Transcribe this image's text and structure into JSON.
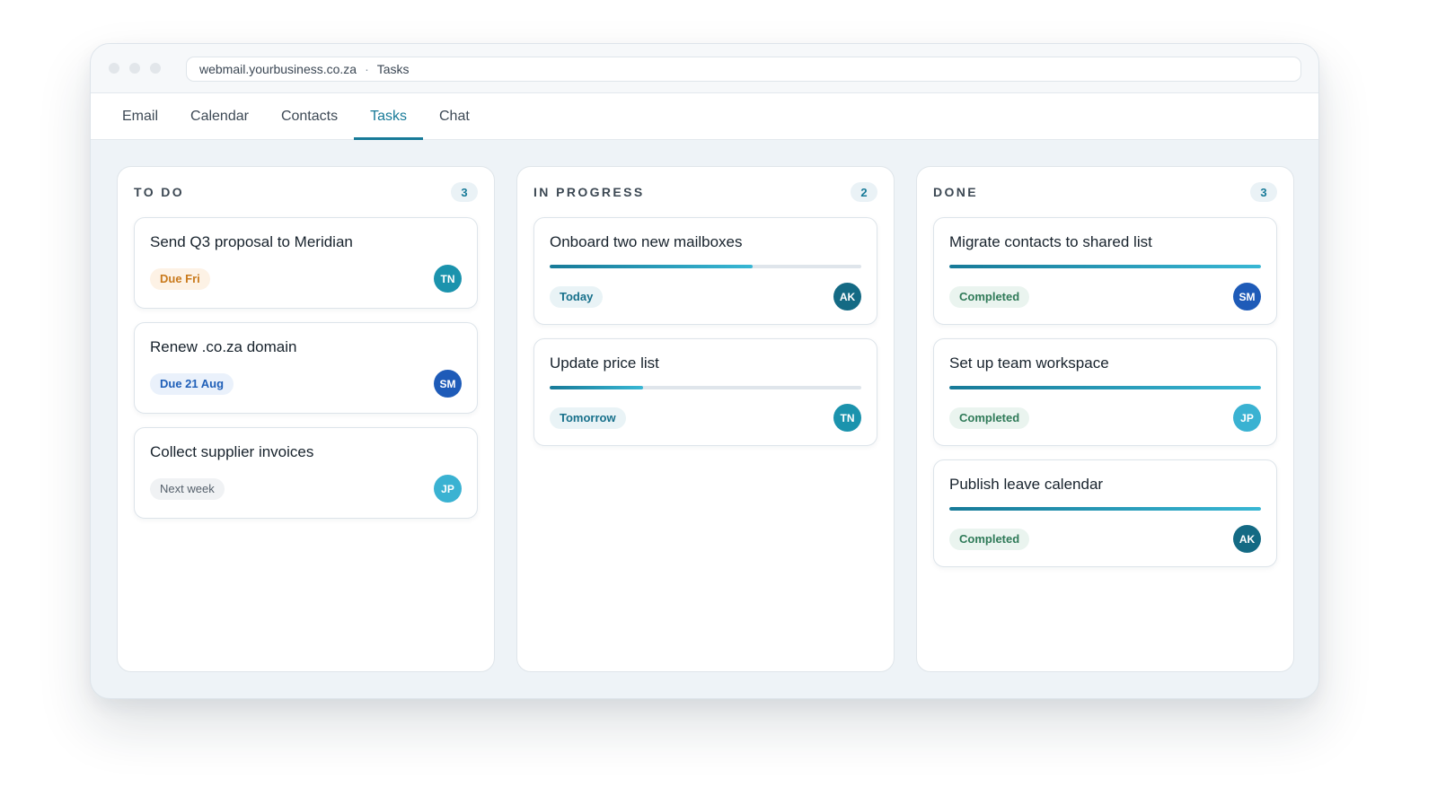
{
  "browser": {
    "url": "webmail.yourbusiness.co.za",
    "separator": "·",
    "page": "Tasks"
  },
  "nav": {
    "tabs": [
      {
        "label": "Email"
      },
      {
        "label": "Calendar"
      },
      {
        "label": "Contacts"
      },
      {
        "label": "Tasks",
        "active": true
      },
      {
        "label": "Chat"
      }
    ]
  },
  "columns": [
    {
      "title": "TO DO",
      "count": "3",
      "cards": [
        {
          "title": "Send Q3 proposal to Meridian",
          "chip": "Due Fri",
          "chip_color": "#c97a1c",
          "assignee": "TN",
          "assignee_color": "#1b93ad"
        },
        {
          "title": "Renew .co.za domain",
          "chip": "Due 21 Aug",
          "chip_color": "#1f5fb8",
          "assignee": "SM",
          "assignee_color": "#1e5bb8"
        },
        {
          "title": "Collect supplier invoices",
          "chip": "Next week",
          "chip_color": "#56616c",
          "assignee": "JP",
          "assignee_color": "#3ab2d2"
        }
      ]
    },
    {
      "title": "IN PROGRESS",
      "count": "2",
      "cards": [
        {
          "title": "Onboard two new mailboxes",
          "progress": 0.65,
          "chip": "Today",
          "chip_color": "#17708b",
          "assignee": "AK",
          "assignee_color": "#146a84"
        },
        {
          "title": "Update price list",
          "progress": 0.3,
          "chip": "Tomorrow",
          "chip_color": "#17708b",
          "assignee": "TN",
          "assignee_color": "#1b93ad"
        }
      ]
    },
    {
      "title": "DONE",
      "count": "3",
      "cards": [
        {
          "title": "Migrate contacts to shared list",
          "progress": 1.0,
          "chip": "Completed",
          "chip_color": "#2f7a58",
          "assignee": "SM",
          "assignee_color": "#1e5bb8"
        },
        {
          "title": "Set up team workspace",
          "progress": 1.0,
          "chip": "Completed",
          "chip_color": "#2f7a58",
          "assignee": "JP",
          "assignee_color": "#3ab2d2"
        },
        {
          "title": "Publish leave calendar",
          "progress": 1.0,
          "chip": "Completed",
          "chip_color": "#2f7a58",
          "assignee": "AK",
          "assignee_color": "#146a84"
        }
      ]
    }
  ]
}
